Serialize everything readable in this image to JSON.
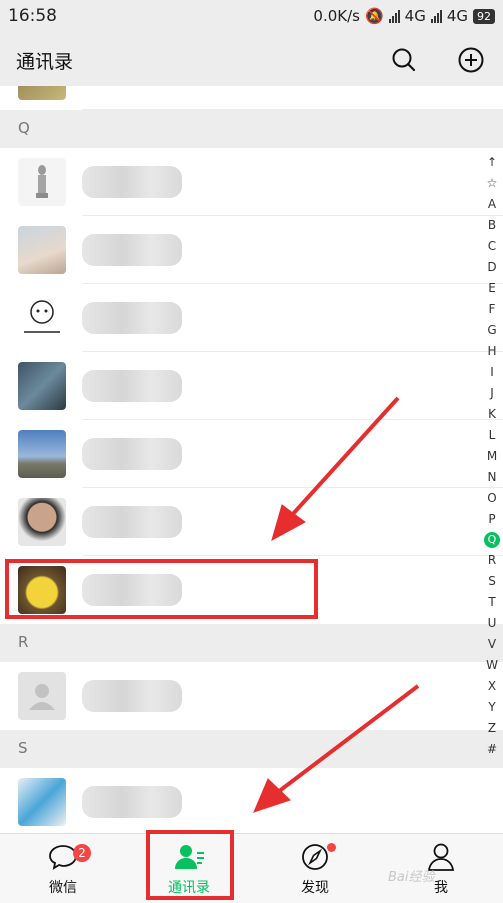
{
  "status_bar": {
    "time": "16:58",
    "net_speed": "0.0K/s",
    "network1": "4G",
    "network2": "4G",
    "battery": "92"
  },
  "header": {
    "title": "通讯录"
  },
  "sections": [
    {
      "letter": "Q"
    },
    {
      "letter": "R"
    },
    {
      "letter": "S"
    }
  ],
  "index_letters": [
    "↑",
    "☆",
    "A",
    "B",
    "C",
    "D",
    "E",
    "F",
    "G",
    "H",
    "I",
    "J",
    "K",
    "L",
    "M",
    "N",
    "O",
    "P",
    "Q",
    "R",
    "S",
    "T",
    "U",
    "V",
    "W",
    "X",
    "Y",
    "Z",
    "#"
  ],
  "index_active": "Q",
  "tabs": [
    {
      "label": "微信",
      "badge": "2",
      "icon": "chat-icon"
    },
    {
      "label": "通讯录",
      "icon": "contacts-icon",
      "active": true
    },
    {
      "label": "发现",
      "icon": "compass-icon",
      "dot": true
    },
    {
      "label": "我",
      "icon": "person-icon"
    }
  ],
  "colors": {
    "accent": "#07c160",
    "annotation_red": "#e62e2e",
    "badge_red": "#f54545"
  },
  "watermark": "Bai经验"
}
